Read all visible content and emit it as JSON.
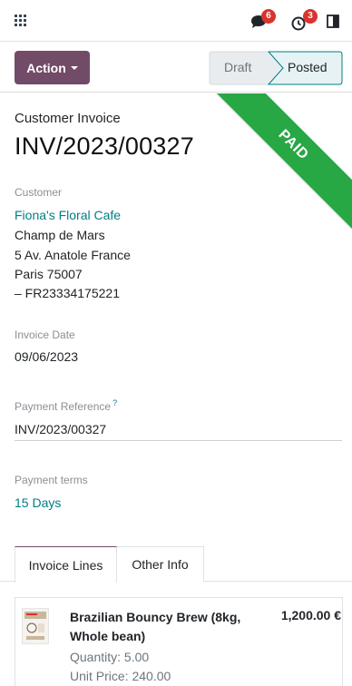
{
  "navbar": {
    "apps_icon": "grid-icon",
    "messages_badge": "6",
    "activities_badge": "3"
  },
  "control": {
    "action_label": "Action",
    "status_steps": [
      {
        "label": "Draft",
        "active": false
      },
      {
        "label": "Posted",
        "active": true
      }
    ]
  },
  "ribbon": {
    "text": "PAID",
    "color": "#28a745"
  },
  "document": {
    "type": "Customer Invoice",
    "name": "INV/2023/00327"
  },
  "customer": {
    "label": "Customer",
    "name": "Fiona's Floral Cafe",
    "address_line1": "Champ de Mars",
    "address_line2": "5 Av. Anatole France",
    "address_line3": "Paris 75007",
    "address_line4": "– FR23334175221"
  },
  "invoice_date": {
    "label": "Invoice Date",
    "value": "09/06/2023"
  },
  "payment_reference": {
    "label": "Payment Reference",
    "help": "?",
    "value": "INV/2023/00327"
  },
  "payment_terms": {
    "label": "Payment terms",
    "value": "15 Days"
  },
  "tabs": [
    {
      "label": "Invoice Lines",
      "active": true
    },
    {
      "label": "Other Info",
      "active": false
    }
  ],
  "lines": [
    {
      "product": "Brazilian Bouncy Brew (8kg, Whole bean)",
      "amount": "1,200.00 €",
      "quantity": "Quantity: 5.00",
      "unit_price": "Unit Price: 240.00"
    }
  ],
  "colors": {
    "brand": "#714b67",
    "link": "#017e84",
    "badge": "#d9332e"
  }
}
